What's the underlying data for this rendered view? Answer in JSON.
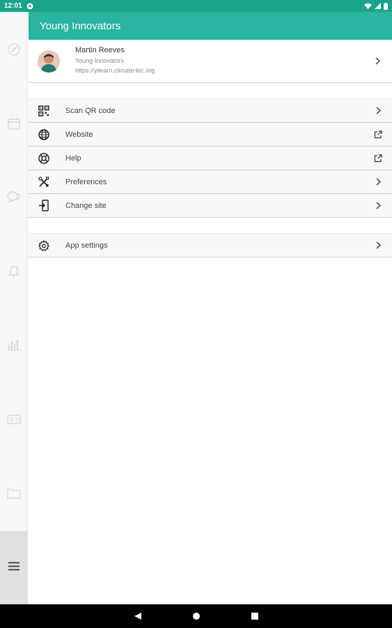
{
  "status_bar": {
    "time": "12:01"
  },
  "header": {
    "title": "Young Innovators"
  },
  "profile": {
    "name": "Martin Reeves",
    "site_name": "Young Innovators",
    "site_url": "https://yilearn.climate-kic.org"
  },
  "menu_group_1": [
    {
      "label": "Scan QR code",
      "icon": "qr-code-icon",
      "trailing": "chevron-right-icon"
    },
    {
      "label": "Website",
      "icon": "globe-icon",
      "trailing": "external-link-icon"
    },
    {
      "label": "Help",
      "icon": "lifebuoy-icon",
      "trailing": "external-link-icon"
    },
    {
      "label": "Preferences",
      "icon": "tools-icon",
      "trailing": "chevron-right-icon"
    },
    {
      "label": "Change site",
      "icon": "change-site-icon",
      "trailing": "chevron-right-icon"
    }
  ],
  "menu_group_2": [
    {
      "label": "App settings",
      "icon": "gear-icon",
      "trailing": "chevron-right-icon"
    }
  ],
  "rail_icons": [
    "compass-icon",
    "calendar-icon",
    "chat-icon",
    "bell-icon",
    "bar-chart-icon",
    "id-card-icon",
    "folder-icon",
    "hamburger-menu-icon"
  ],
  "colors": {
    "status_bar": "#1aa38b",
    "app_bar": "#2ab5a0",
    "rail": "#f7f8fa",
    "row_bg": "#f7f8fa"
  }
}
